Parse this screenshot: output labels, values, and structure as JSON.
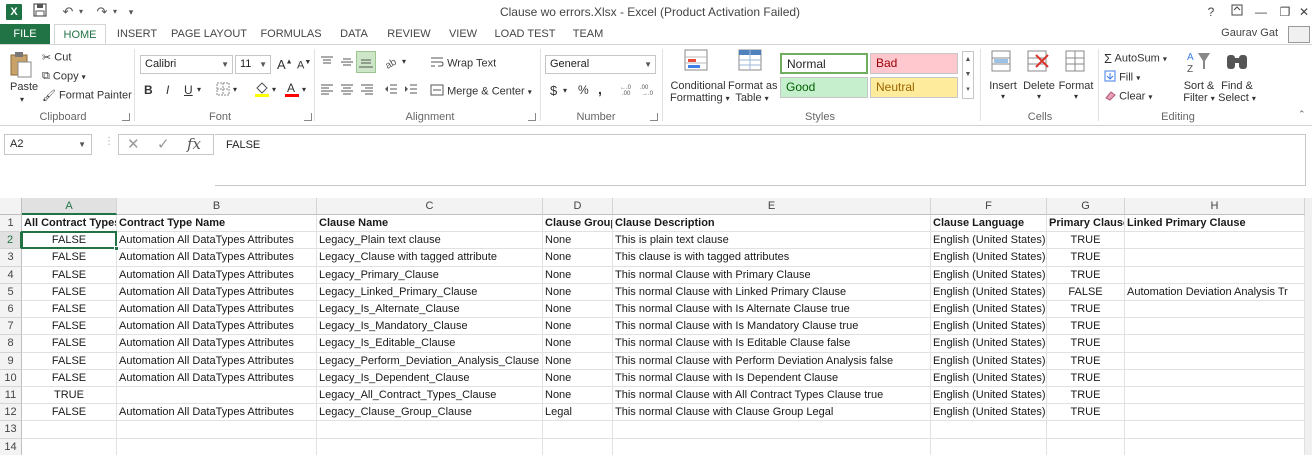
{
  "window": {
    "title": "Clause wo errors.Xlsx - Excel (Product Activation Failed)",
    "app_icon_label": "X",
    "help_label": "?",
    "accent_color": "#217346"
  },
  "ribbon_tabs": [
    {
      "label": "FILE"
    },
    {
      "label": "HOME"
    },
    {
      "label": "INSERT"
    },
    {
      "label": "PAGE LAYOUT"
    },
    {
      "label": "FORMULAS"
    },
    {
      "label": "DATA"
    },
    {
      "label": "REVIEW"
    },
    {
      "label": "VIEW"
    },
    {
      "label": "LOAD TEST"
    },
    {
      "label": "TEAM"
    }
  ],
  "user": {
    "name": "Gaurav Gat"
  },
  "ribbon": {
    "clipboard": {
      "paste": "Paste",
      "cut": "Cut",
      "copy": "Copy",
      "format_painter": "Format Painter",
      "group_label": "Clipboard"
    },
    "font": {
      "font_name": "Calibri",
      "font_size": "11",
      "bold": "B",
      "italic": "I",
      "underline": "U",
      "grow": "A",
      "shrink": "A",
      "group_label": "Font"
    },
    "alignment": {
      "wrap_text": "Wrap Text",
      "merge_center": "Merge & Center",
      "group_label": "Alignment"
    },
    "number": {
      "format": "General",
      "currency": "$",
      "percent": "%",
      "comma": ",",
      "group_label": "Number"
    },
    "styles": {
      "conditional_formatting_1": "Conditional",
      "conditional_formatting_2": "Formatting",
      "format_as_table_1": "Format as",
      "format_as_table_2": "Table",
      "normal": "Normal",
      "bad": "Bad",
      "good": "Good",
      "neutral": "Neutral",
      "group_label": "Styles"
    },
    "cells": {
      "insert": "Insert",
      "delete": "Delete",
      "format": "Format",
      "group_label": "Cells"
    },
    "editing": {
      "autosum": "AutoSum",
      "fill": "Fill",
      "clear": "Clear",
      "sort_filter_1": "Sort &",
      "sort_filter_2": "Filter",
      "find_select_1": "Find &",
      "find_select_2": "Select",
      "group_label": "Editing"
    }
  },
  "formula_bar": {
    "name_box": "A2",
    "fx": "fx",
    "value": "FALSE"
  },
  "sheet": {
    "columns": [
      "A",
      "B",
      "C",
      "D",
      "E",
      "F",
      "G",
      "H"
    ],
    "header_row": [
      "All Contract Types",
      "Contract Type Name",
      "Clause Name",
      "Clause Group",
      "Clause Description",
      "Clause Language",
      "Primary Clause",
      "Linked Primary Clause"
    ],
    "rows": [
      [
        "FALSE",
        "Automation All DataTypes Attributes",
        "Legacy_Plain text clause",
        "None",
        "This is plain text clause",
        "English (United States)",
        "TRUE",
        ""
      ],
      [
        "FALSE",
        "Automation All DataTypes Attributes",
        "Legacy_Clause with tagged attribute",
        "None",
        "This clause is with tagged attributes",
        "English (United States)",
        "TRUE",
        ""
      ],
      [
        "FALSE",
        "Automation All DataTypes Attributes",
        "Legacy_Primary_Clause",
        "None",
        "This normal Clause with Primary Clause",
        "English (United States)",
        "TRUE",
        ""
      ],
      [
        "FALSE",
        "Automation All DataTypes Attributes",
        "Legacy_Linked_Primary_Clause",
        "None",
        "This normal Clause with Linked Primary Clause",
        "English (United States)",
        "FALSE",
        "Automation Deviation Analysis Tr"
      ],
      [
        "FALSE",
        "Automation All DataTypes Attributes",
        "Legacy_Is_Alternate_Clause",
        "None",
        "This normal Clause with Is Alternate Clause true",
        "English (United States)",
        "TRUE",
        ""
      ],
      [
        "FALSE",
        "Automation All DataTypes Attributes",
        "Legacy_Is_Mandatory_Clause",
        "None",
        "This normal Clause with Is Mandatory Clause true",
        "English (United States)",
        "TRUE",
        ""
      ],
      [
        "FALSE",
        "Automation All DataTypes Attributes",
        "Legacy_Is_Editable_Clause",
        "None",
        "This normal Clause with Is Editable Clause false",
        "English (United States)",
        "TRUE",
        ""
      ],
      [
        "FALSE",
        "Automation All DataTypes Attributes",
        "Legacy_Perform_Deviation_Analysis_Clause",
        "None",
        "This normal Clause with Perform Deviation Analysis false",
        "English (United States)",
        "TRUE",
        ""
      ],
      [
        "FALSE",
        "Automation All DataTypes Attributes",
        "Legacy_Is_Dependent_Clause",
        "None",
        "This normal Clause with Is Dependent Clause",
        "English (United States)",
        "TRUE",
        ""
      ],
      [
        "TRUE",
        "",
        "Legacy_All_Contract_Types_Clause",
        "None",
        "This normal Clause with All Contract Types Clause true",
        "English (United States)",
        "TRUE",
        ""
      ],
      [
        "FALSE",
        "Automation All DataTypes Attributes",
        "Legacy_Clause_Group_Clause",
        "Legal",
        "This normal Clause with Clause Group Legal",
        "English (United States)",
        "TRUE",
        ""
      ],
      [
        "",
        "",
        "",
        "",
        "",
        "",
        "",
        ""
      ],
      [
        "",
        "",
        "",
        "",
        "",
        "",
        "",
        ""
      ]
    ],
    "row_numbers": [
      "1",
      "2",
      "3",
      "4",
      "5",
      "6",
      "7",
      "8",
      "9",
      "10",
      "11",
      "12",
      "13",
      "14"
    ]
  }
}
